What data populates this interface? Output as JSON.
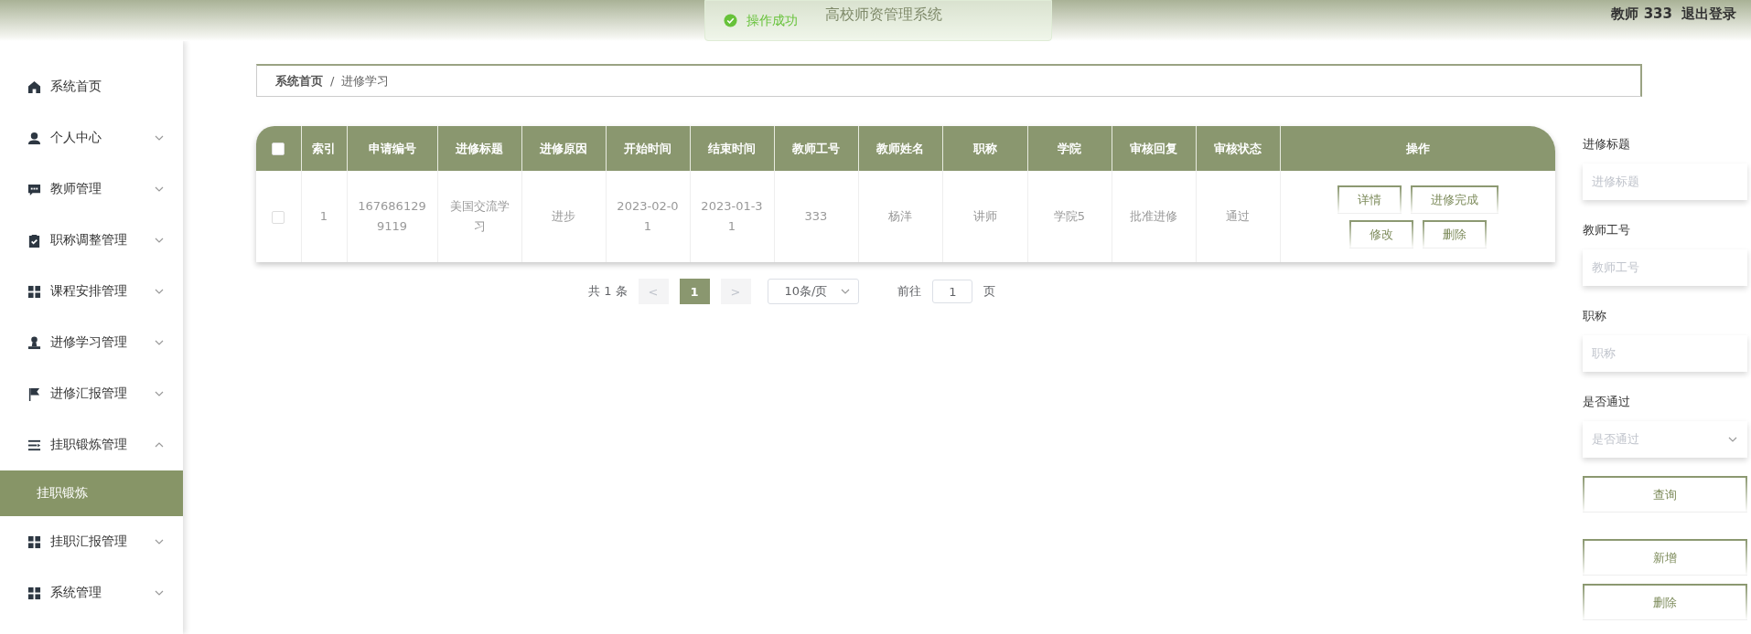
{
  "header": {
    "title": "高校师资管理系统",
    "toast": "操作成功",
    "user": "教师 333",
    "logout": "退出登录"
  },
  "sidebar": {
    "items": [
      {
        "label": "系统首页",
        "kind": "link"
      },
      {
        "label": "个人中心",
        "kind": "group",
        "expanded": false
      },
      {
        "label": "教师管理",
        "kind": "group",
        "expanded": false
      },
      {
        "label": "职称调整管理",
        "kind": "group",
        "expanded": false
      },
      {
        "label": "课程安排管理",
        "kind": "group",
        "expanded": false
      },
      {
        "label": "进修学习管理",
        "kind": "group",
        "expanded": false
      },
      {
        "label": "进修汇报管理",
        "kind": "group",
        "expanded": false
      },
      {
        "label": "挂职锻炼管理",
        "kind": "group",
        "expanded": true,
        "children": [
          {
            "label": "挂职锻炼",
            "selected": true
          }
        ]
      },
      {
        "label": "挂职汇报管理",
        "kind": "group",
        "expanded": false
      },
      {
        "label": "系统管理",
        "kind": "group",
        "expanded": false
      }
    ]
  },
  "breadcrumb": {
    "separator": "/",
    "items": [
      "系统首页",
      "进修学习"
    ]
  },
  "table": {
    "select_all_checked": false,
    "columns": [
      "索引",
      "申请编号",
      "进修标题",
      "进修原因",
      "开始时间",
      "结束时间",
      "教师工号",
      "教师姓名",
      "职称",
      "学院",
      "审核回复",
      "审核状态",
      "操作"
    ],
    "rows": [
      {
        "checked": false,
        "cells": [
          "1",
          "1676861299119",
          "美国交流学习",
          "进步",
          "2023-02-01",
          "2023-01-31",
          "333",
          "杨洋",
          "讲师",
          "学院5",
          "批准进修",
          "通过"
        ],
        "actions": [
          "详情",
          "进修完成",
          "修改",
          "删除"
        ]
      }
    ]
  },
  "pagination": {
    "total": "共 1 条",
    "prev": "<",
    "pages": [
      {
        "label": "1",
        "selected": true
      }
    ],
    "next": ">",
    "page_size": "10条/页",
    "goto": "前往",
    "goto_value": "1",
    "page_unit": "页"
  },
  "search": {
    "fields": [
      {
        "label": "进修标题",
        "placeholder": "进修标题",
        "kind": "text"
      },
      {
        "label": "教师工号",
        "placeholder": "教师工号",
        "kind": "text"
      },
      {
        "label": "职称",
        "placeholder": "职称",
        "kind": "text"
      },
      {
        "label": "是否通过",
        "placeholder": "是否通过",
        "kind": "select"
      }
    ],
    "query_button": "查询",
    "buttons": [
      "新增",
      "删除"
    ]
  }
}
